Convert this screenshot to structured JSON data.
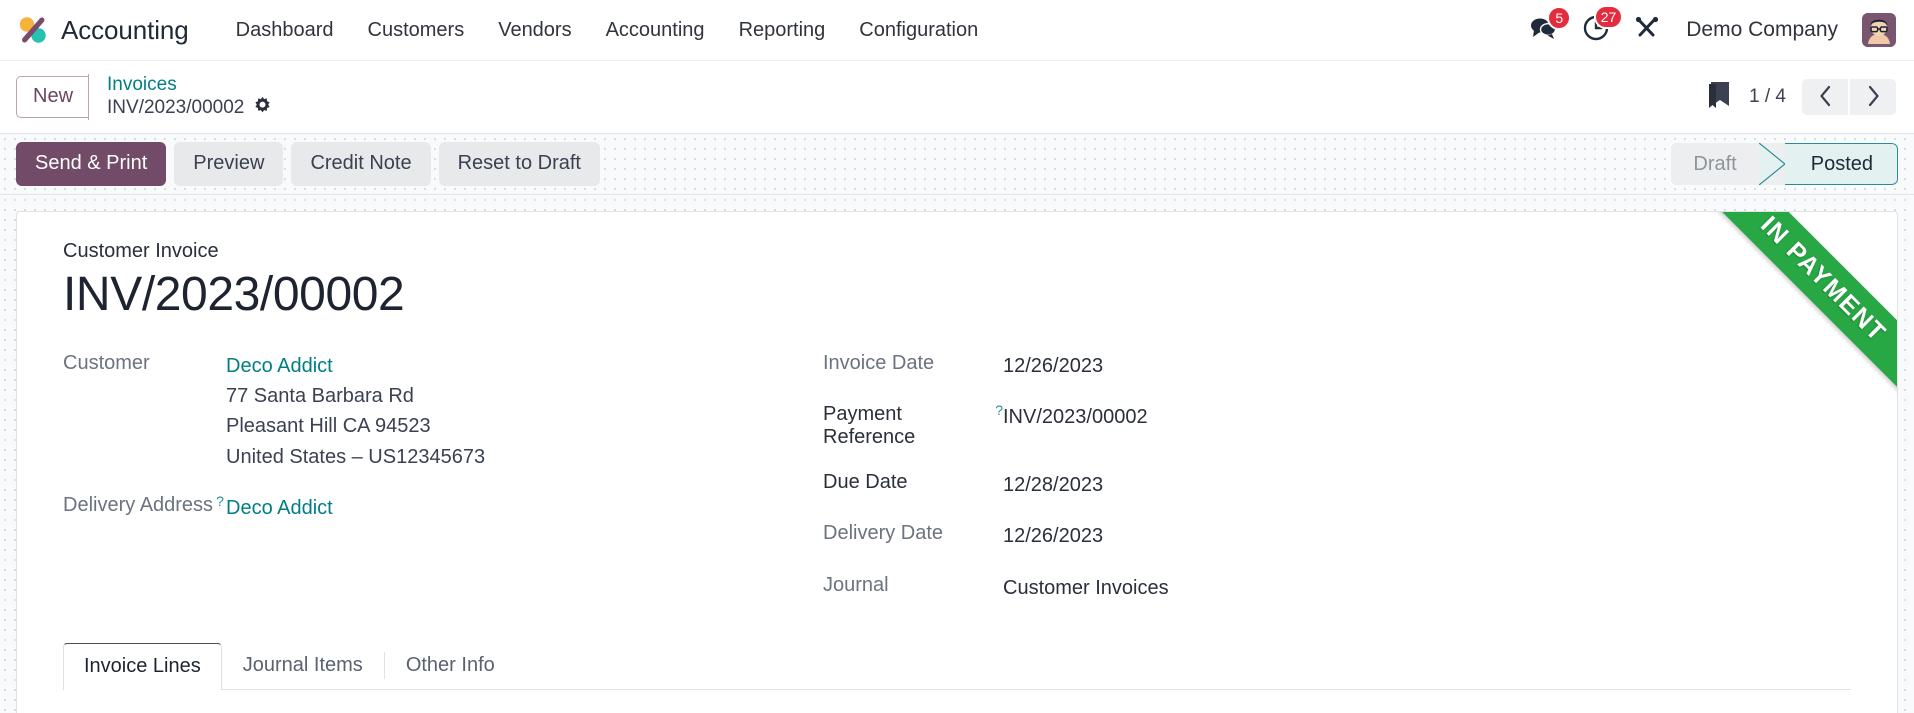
{
  "navbar": {
    "brand": "Accounting",
    "logo_icon": "odoo-logo-icon",
    "menu": [
      {
        "label": "Dashboard"
      },
      {
        "label": "Customers"
      },
      {
        "label": "Vendors"
      },
      {
        "label": "Accounting"
      },
      {
        "label": "Reporting"
      },
      {
        "label": "Configuration"
      }
    ],
    "messages": {
      "icon": "chat-bubbles-icon",
      "count": "5"
    },
    "activities": {
      "icon": "clock-icon",
      "count": "27"
    },
    "debug": {
      "icon": "tools-icon"
    },
    "company": "Demo Company",
    "avatar_icon": "user-avatar-icon"
  },
  "breadcrumb": {
    "new_button": "New",
    "parent": "Invoices",
    "current": "INV/2023/00002",
    "settings_icon": "gear-icon",
    "flag_icon": "bookmark-flag-icon",
    "pager": "1 / 4",
    "prev_icon": "chevron-left-icon",
    "next_icon": "chevron-right-icon"
  },
  "actions": {
    "buttons": [
      {
        "label": "Send & Print",
        "style": "primary"
      },
      {
        "label": "Preview",
        "style": "secondary"
      },
      {
        "label": "Credit Note",
        "style": "secondary"
      },
      {
        "label": "Reset to Draft",
        "style": "secondary"
      }
    ]
  },
  "statusbar": {
    "steps": [
      {
        "label": "Draft",
        "active": false
      },
      {
        "label": "Posted",
        "active": true
      }
    ]
  },
  "sheet": {
    "ribbon": "IN PAYMENT",
    "doc_type": "Customer Invoice",
    "doc_title": "INV/2023/00002",
    "left": {
      "customer_label": "Customer",
      "customer_name": "Deco Addict",
      "address_line1": "77 Santa Barbara Rd",
      "address_line2": "Pleasant Hill CA 94523",
      "address_line3": "United States – US12345673",
      "delivery_label": "Delivery Address",
      "delivery_help": "?",
      "delivery_value": "Deco Addict"
    },
    "right": {
      "invoice_date_label": "Invoice Date",
      "invoice_date_value": "12/26/2023",
      "payment_reference_label": "Payment Reference",
      "payment_reference_help": "?",
      "payment_reference_value": "INV/2023/00002",
      "due_date_label": "Due Date",
      "due_date_value": "12/28/2023",
      "delivery_date_label": "Delivery Date",
      "delivery_date_value": "12/26/2023",
      "journal_label": "Journal",
      "journal_value": "Customer Invoices"
    },
    "tabs": [
      {
        "label": "Invoice Lines",
        "active": true
      },
      {
        "label": "Journal Items",
        "active": false
      },
      {
        "label": "Other Info",
        "active": false
      }
    ]
  },
  "colors": {
    "primary": "#714b67",
    "link": "#017e84",
    "badge": "#e32d3f",
    "ribbon_green": "#28a745",
    "status_active_border": "#2b8c96"
  }
}
